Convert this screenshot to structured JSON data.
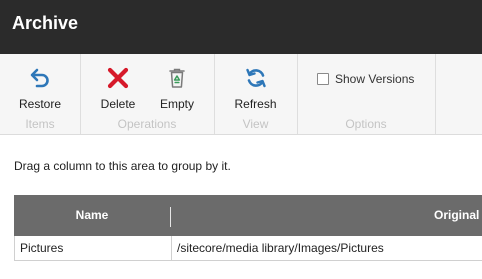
{
  "app": {
    "title": "Archive"
  },
  "ribbon": {
    "groups": [
      {
        "label": "Items",
        "buttons": [
          {
            "label": "Restore",
            "icon": "restore-arrow-icon"
          }
        ]
      },
      {
        "label": "Operations",
        "buttons": [
          {
            "label": "Delete",
            "icon": "delete-x-icon"
          },
          {
            "label": "Empty",
            "icon": "recycle-bin-icon"
          }
        ]
      },
      {
        "label": "View",
        "buttons": [
          {
            "label": "Refresh",
            "icon": "refresh-icon"
          }
        ]
      },
      {
        "label": "Options",
        "checkbox": {
          "label": "Show Versions",
          "checked": false
        }
      }
    ]
  },
  "grid": {
    "group_hint": "Drag a column to this area to group by it.",
    "columns": [
      "Name",
      "Original"
    ],
    "rows": [
      {
        "name": "Pictures",
        "original": "/sitecore/media library/Images/Pictures"
      }
    ]
  },
  "colors": {
    "titlebar": "#2b2b2b",
    "ribbon": "#f6f6f6",
    "grid_header": "#6b6b6b",
    "accent_blue": "#2e77b8",
    "delete_red": "#d6192a",
    "bin_green": "#3a9a5a"
  }
}
